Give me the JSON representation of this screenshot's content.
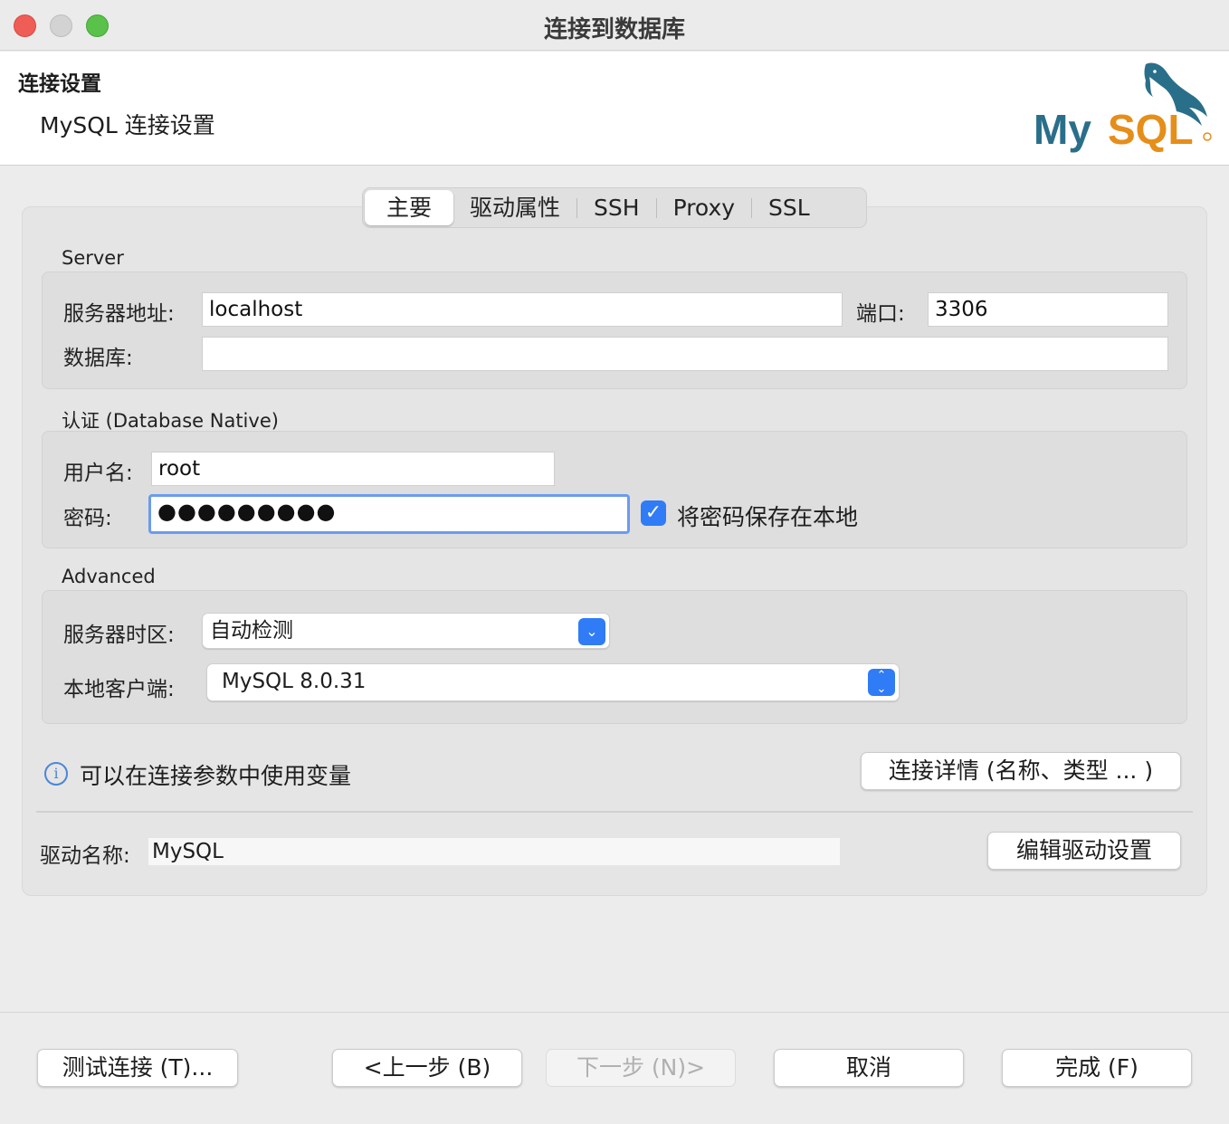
{
  "window": {
    "title": "连接到数据库"
  },
  "header": {
    "title": "连接设置",
    "subtitle": "MySQL 连接设置",
    "logo_text": "MySQL"
  },
  "tabs": [
    {
      "label": "主要",
      "active": true
    },
    {
      "label": "驱动属性"
    },
    {
      "label": "SSH"
    },
    {
      "label": "Proxy"
    },
    {
      "label": "SSL"
    }
  ],
  "server": {
    "section_label": "Server",
    "host_label": "服务器地址:",
    "host_value": "localhost",
    "port_label": "端口:",
    "port_value": "3306",
    "database_label": "数据库:",
    "database_value": ""
  },
  "auth": {
    "section_label": "认证 (Database Native)",
    "username_label": "用户名:",
    "username_value": "root",
    "password_label": "密码:",
    "password_value": "●●●●●●●●●",
    "save_password_checked": true,
    "save_password_label": "将密码保存在本地"
  },
  "advanced": {
    "section_label": "Advanced",
    "timezone_label": "服务器时区:",
    "timezone_value": "自动检测",
    "client_label": "本地客户端:",
    "client_value": "MySQL 8.0.31"
  },
  "info": {
    "text": "可以在连接参数中使用变量",
    "details_button": "连接详情 (名称、类型 ... )"
  },
  "driver": {
    "name_label": "驱动名称:",
    "name_value": "MySQL",
    "edit_button": "编辑驱动设置"
  },
  "footer": {
    "test_button": "测试连接 (T)...",
    "back_button": "<上一步 (B)",
    "next_button": "下一步 (N)>",
    "cancel_button": "取消",
    "finish_button": "完成 (F)"
  },
  "colors": {
    "accent": "#2f7cf6",
    "logo_blue": "#2a6f8a",
    "logo_orange": "#e58e1a"
  }
}
